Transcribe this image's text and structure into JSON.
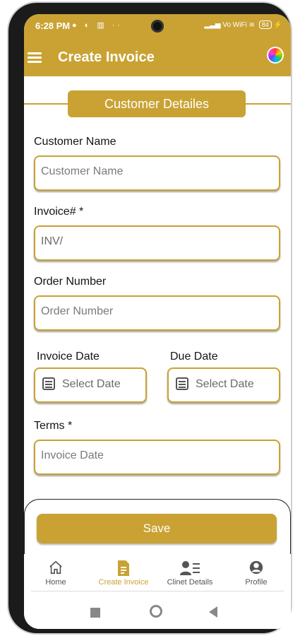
{
  "status_bar": {
    "time": "6:28 PM",
    "network": "Vo WiFi",
    "battery": "84"
  },
  "app_bar": {
    "title": "Create Invoice"
  },
  "section": {
    "title": "Customer Detailes"
  },
  "form": {
    "customer_name_label": "Customer Name",
    "customer_name_placeholder": "Customer Name",
    "invoice_label": "Invoice# *",
    "invoice_value": "INV/",
    "order_number_label": "Order Number",
    "order_number_placeholder": "Order Number",
    "invoice_date_label": "Invoice Date",
    "invoice_date_value": "Select Date",
    "due_date_label": "Due Date",
    "due_date_value": "Select Date",
    "terms_label": "Terms *",
    "terms_placeholder": "Invoice Date"
  },
  "save_label": "Save",
  "bottom_nav": [
    {
      "label": "Home",
      "icon": "home-icon",
      "active": false
    },
    {
      "label": "Create Invoice",
      "icon": "document-icon",
      "active": true
    },
    {
      "label": "Clinet Details",
      "icon": "client-details-icon",
      "active": false
    },
    {
      "label": "Profile",
      "icon": "profile-icon",
      "active": false
    }
  ],
  "colors": {
    "accent": "#c9a233",
    "text": "#141414"
  }
}
